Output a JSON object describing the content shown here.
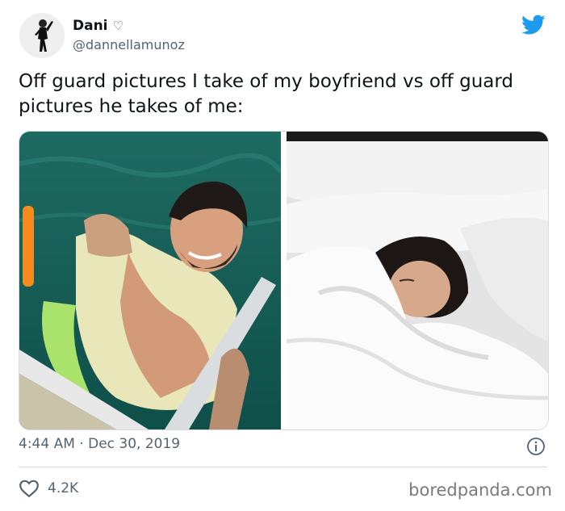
{
  "user": {
    "display_name": "Dani",
    "handle": "@dannellamunoz"
  },
  "tweet": {
    "text": "Off guard pictures I take of my boyfriend vs off guard pictures he takes of me:",
    "time": "4:44 AM",
    "separator": "·",
    "date": "Dec 30, 2019",
    "like_count": "4.2K"
  },
  "media": {
    "left_photo": "man-in-life-vest-in-water",
    "right_photo": "woman-sleeping-under-duvet"
  },
  "icons": {
    "verified_like": "heart-outline-icon",
    "brand": "twitter-bird-icon",
    "info": "info-icon",
    "like": "heart-icon"
  },
  "colors": {
    "twitter_blue": "#1d9bf0",
    "text": "#0f1419",
    "muted": "#536471"
  },
  "watermark": "boredpanda.com"
}
